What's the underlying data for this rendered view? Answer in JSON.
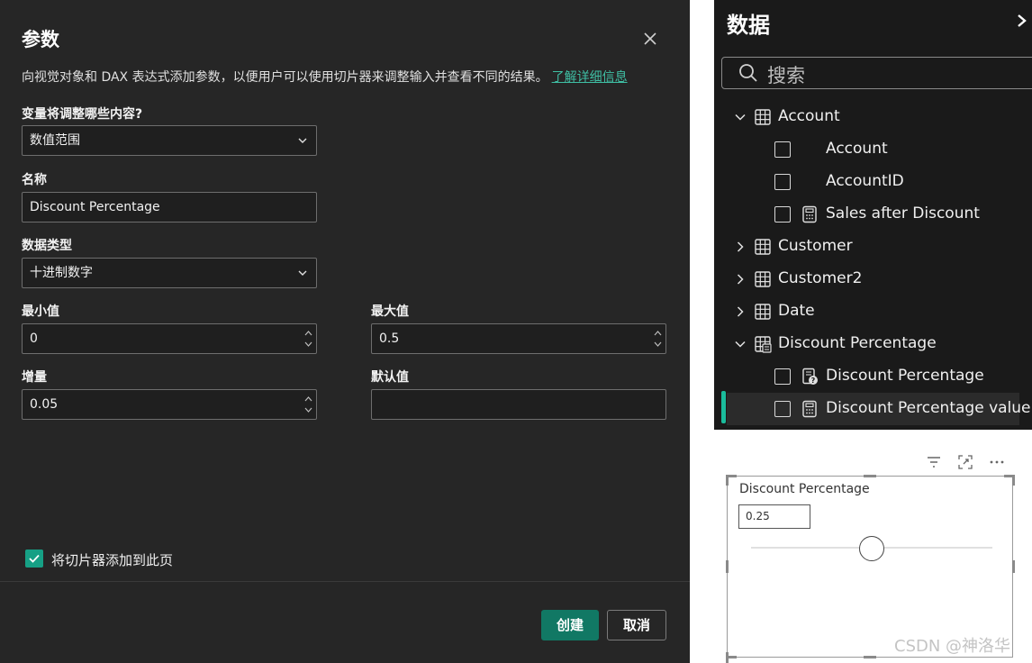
{
  "dialog": {
    "title": "参数",
    "description": "向视觉对象和 DAX 表达式添加参数，以便用户可以使用切片器来调整输入并查看不同的结果。",
    "learn_more": "了解详细信息",
    "fields": {
      "adjust_label": "变量将调整哪些内容?",
      "adjust_value": "数值范围",
      "name_label": "名称",
      "name_value": "Discount Percentage",
      "type_label": "数据类型",
      "type_value": "十进制数字",
      "min_label": "最小值",
      "min_value": "0",
      "max_label": "最大值",
      "max_value": "0.5",
      "increment_label": "增量",
      "increment_value": "0.05",
      "default_label": "默认值",
      "default_value": ""
    },
    "add_slicer_label": "将切片器添加到此页",
    "add_slicer_checked": true,
    "create_button": "创建",
    "cancel_button": "取消"
  },
  "data_pane": {
    "title": "数据",
    "search_placeholder": "搜索",
    "tree": [
      {
        "text": "Account",
        "kind": "table",
        "expanded": true
      },
      {
        "text": "Account",
        "kind": "field"
      },
      {
        "text": "AccountID",
        "kind": "field"
      },
      {
        "text": "Sales after Discount",
        "kind": "measure"
      },
      {
        "text": "Customer",
        "kind": "table",
        "expanded": false
      },
      {
        "text": "Customer2",
        "kind": "table",
        "expanded": false
      },
      {
        "text": "Date",
        "kind": "table",
        "expanded": false
      },
      {
        "text": "Discount Percentage",
        "kind": "parameter-table",
        "expanded": true
      },
      {
        "text": "Discount Percentage",
        "kind": "parameter-field"
      },
      {
        "text": "Discount Percentage value",
        "kind": "measure",
        "selected": true
      }
    ]
  },
  "slicer": {
    "title": "Discount Percentage",
    "value": "0.25",
    "min": 0,
    "max": 0.5,
    "position": 0.25
  },
  "watermark": "CSDN @神洛华",
  "colors": {
    "accent": "#16a085",
    "primary_button": "#117864",
    "link": "#3fbfa4",
    "dialog_bg": "#262626",
    "pane_bg": "#1a1a1a"
  }
}
